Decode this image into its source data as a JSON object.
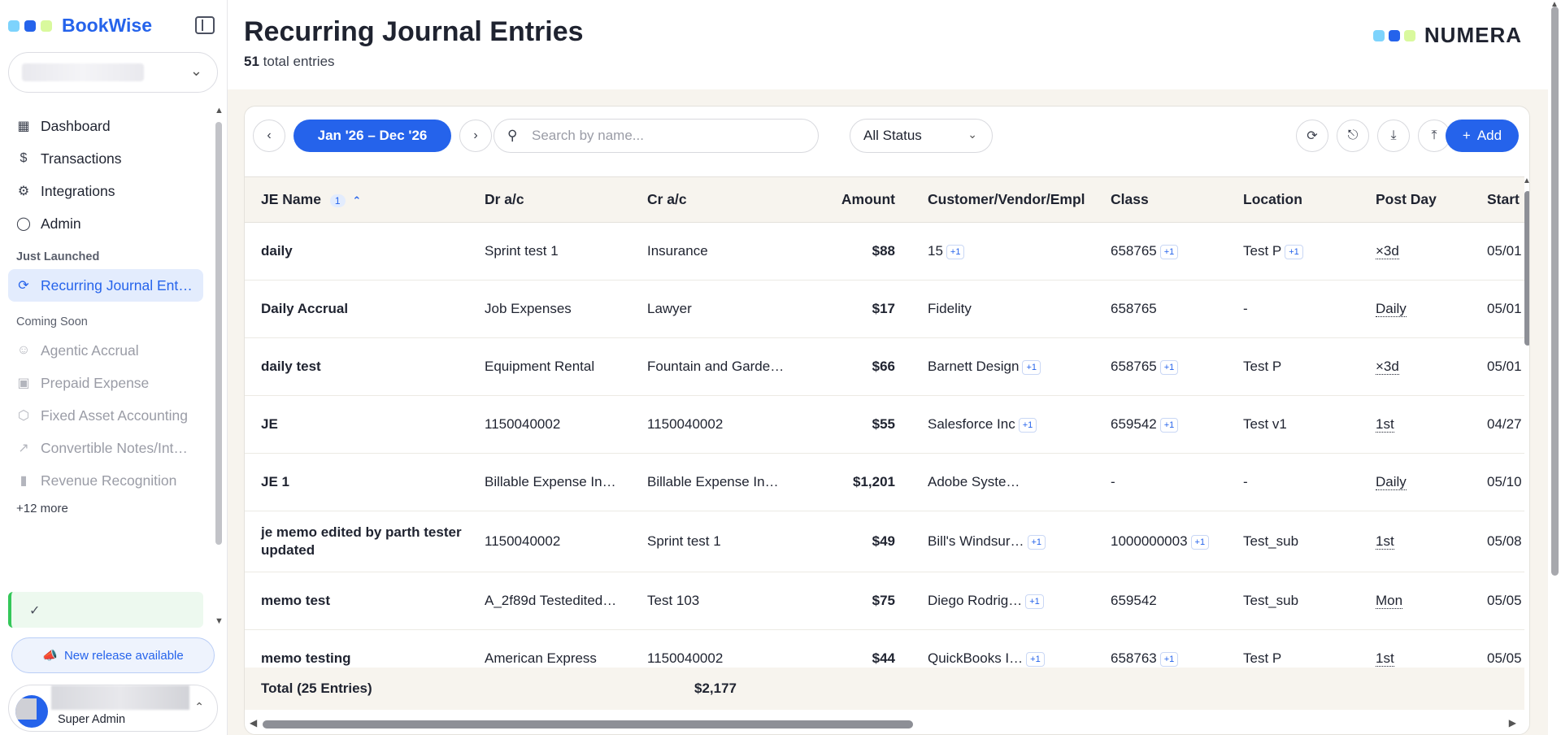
{
  "app": {
    "name": "BookWise"
  },
  "sidebar": {
    "nav": [
      {
        "label": "Dashboard",
        "icon": "dashboard-icon"
      },
      {
        "label": "Transactions",
        "icon": "dollar-document-icon"
      },
      {
        "label": "Integrations",
        "icon": "gear-icon"
      },
      {
        "label": "Admin",
        "icon": "shield-icon"
      }
    ],
    "just_launched_label": "Just Launched",
    "just_launched": [
      {
        "label": "Recurring Journal Ent…",
        "icon": "refresh-icon"
      }
    ],
    "coming_soon_label": "Coming Soon",
    "coming_soon": [
      {
        "label": "Agentic Accrual",
        "icon": "robot-icon"
      },
      {
        "label": "Prepaid Expense",
        "icon": "wallet-icon"
      },
      {
        "label": "Fixed Asset Accounting",
        "icon": "box-icon"
      },
      {
        "label": "Convertible Notes/Int…",
        "icon": "trend-icon"
      },
      {
        "label": "Revenue Recognition",
        "icon": "bar-chart-icon"
      }
    ],
    "more_label": "+12 more",
    "release_label": "New release available",
    "user_role": "Super Admin"
  },
  "header": {
    "title": "Recurring Journal Entries",
    "count": "51",
    "count_suffix": "total entries",
    "logo_text": "NUMERA"
  },
  "toolbar": {
    "date_range": "Jan '26 – Dec '26",
    "search_placeholder": "Search by name...",
    "status_value": "All Status",
    "add_label": "Add"
  },
  "table": {
    "columns": [
      "JE Name",
      "Dr a/c",
      "Cr a/c",
      "Amount",
      "Customer/Vendor/Empl",
      "Class",
      "Location",
      "Post Day",
      "Start"
    ],
    "sort_badge": "1",
    "rows": [
      {
        "name": "daily",
        "dr": "Sprint test 1",
        "cr": "Insurance",
        "amount": "$88",
        "cve": "15",
        "cve_badge": "+1",
        "cls": "658765",
        "cls_badge": "+1",
        "loc": "Test P",
        "loc_badge": "+1",
        "post": "×3d",
        "start": "05/01"
      },
      {
        "name": "Daily Accrual",
        "dr": "Job Expenses",
        "cr": "Lawyer",
        "amount": "$17",
        "cve": "Fidelity",
        "cve_badge": "",
        "cls": "658765",
        "cls_badge": "",
        "loc": "-",
        "loc_badge": "",
        "post": "Daily",
        "start": "05/01"
      },
      {
        "name": "daily test",
        "dr": "Equipment Rental",
        "cr": "Fountain and Garde…",
        "amount": "$66",
        "cve": "Barnett Design",
        "cve_badge": "+1",
        "cls": "658765",
        "cls_badge": "+1",
        "loc": "Test P",
        "loc_badge": "",
        "post": "×3d",
        "start": "05/01"
      },
      {
        "name": "JE",
        "dr": "1150040002",
        "cr": "1150040002",
        "amount": "$55",
        "cve": "Salesforce Inc",
        "cve_badge": "+1",
        "cls": "659542",
        "cls_badge": "+1",
        "loc": "Test v1",
        "loc_badge": "",
        "post": "1st",
        "start": "04/27"
      },
      {
        "name": "JE 1",
        "dr": "Billable Expense In…",
        "cr": "Billable Expense In…",
        "amount": "$1,201",
        "cve": "Adobe Syste…",
        "cve_badge": "",
        "cls": "-",
        "cls_badge": "",
        "loc": "-",
        "loc_badge": "",
        "post": "Daily",
        "start": "05/10"
      },
      {
        "name": "je memo edited by parth tester updated",
        "dr": "1150040002",
        "cr": "Sprint test 1",
        "amount": "$49",
        "cve": "Bill's Windsur…",
        "cve_badge": "+1",
        "cls": "1000000003",
        "cls_badge": "+1",
        "loc": "Test_sub",
        "loc_badge": "",
        "post": "1st",
        "start": "05/08"
      },
      {
        "name": "memo test",
        "dr": "A_2f89d Testedited…",
        "cr": "Test 103",
        "amount": "$75",
        "cve": "Diego Rodrig…",
        "cve_badge": "+1",
        "cls": "659542",
        "cls_badge": "",
        "loc": "Test_sub",
        "loc_badge": "",
        "post": "Mon",
        "start": "05/05"
      },
      {
        "name": "memo testing",
        "dr": "American Express",
        "cr": "1150040002",
        "amount": "$44",
        "cve": "QuickBooks I…",
        "cve_badge": "+1",
        "cls": "658763",
        "cls_badge": "+1",
        "loc": "Test P",
        "loc_badge": "",
        "post": "1st",
        "start": "05/05"
      }
    ],
    "total_label": "Total (25 Entries)",
    "total_amount": "$2,177"
  },
  "colors": {
    "accent": "#2563eb",
    "dot1": "#7dd3fc",
    "dot2": "#2563eb",
    "dot3": "#d9f99d"
  }
}
